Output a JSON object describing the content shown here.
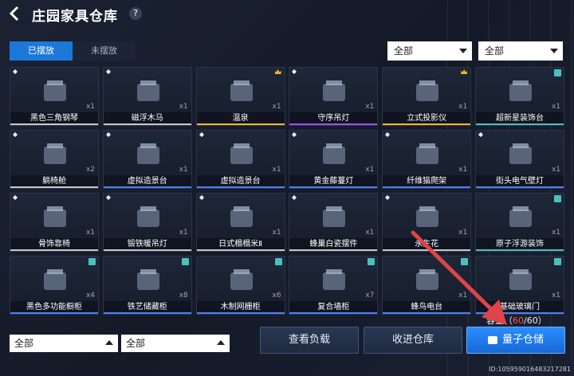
{
  "header": {
    "title": "庄园家具仓库",
    "help": "?"
  },
  "tabs": [
    {
      "label": "已摆放"
    },
    {
      "label": "未摆放"
    }
  ],
  "filters": {
    "top_left": "全部",
    "top_right": "全部",
    "bottom_left": "全部",
    "bottom_right": "全部"
  },
  "items": [
    {
      "name": "黑色三角钢琴",
      "qty": "x1",
      "badge": "gem",
      "rarity": "#c8c8c8"
    },
    {
      "name": "磁浮木马",
      "qty": "x1",
      "badge": "gem",
      "rarity": "#c8c8c8"
    },
    {
      "name": "温泉",
      "qty": "x1",
      "badge": "crown",
      "rarity": "#f0b62d"
    },
    {
      "name": "守序吊灯",
      "qty": "x1",
      "badge": "gem",
      "rarity": "#a64dff"
    },
    {
      "name": "立式投影仪",
      "qty": "x1",
      "badge": "crown",
      "rarity": "#f0b62d"
    },
    {
      "name": "超新星装饰台",
      "qty": "x1",
      "badge": "box",
      "rarity": "#4dbfbf"
    },
    {
      "name": "躺椅舱",
      "qty": "x2",
      "badge": "gem",
      "rarity": "#c8c8c8"
    },
    {
      "name": "虚拟造景台",
      "qty": "x1",
      "badge": "gem",
      "rarity": "#4d7fff"
    },
    {
      "name": "虚拟造景台",
      "qty": "x1",
      "badge": "gem",
      "rarity": "#4d7fff"
    },
    {
      "name": "黄金藤蔓灯",
      "qty": "x1",
      "badge": "gem",
      "rarity": "#4d7fff"
    },
    {
      "name": "纤维猫爬架",
      "qty": "x1",
      "badge": "gem",
      "rarity": "#4d7fff"
    },
    {
      "name": "街头电气壁灯",
      "qty": "x1",
      "badge": "gem",
      "rarity": "#4d7fff"
    },
    {
      "name": "骨饰靠椅",
      "qty": "x1",
      "badge": "gem",
      "rarity": "#c8c8c8"
    },
    {
      "name": "锻铁暖吊灯",
      "qty": "x1",
      "badge": "gem",
      "rarity": "#c8c8c8"
    },
    {
      "name": "日式榻榻米Ⅱ",
      "qty": "x1",
      "badge": "gem",
      "rarity": "#c8c8c8"
    },
    {
      "name": "蜂巢白瓷摆件",
      "qty": "x1",
      "badge": "gem",
      "rarity": "#c8c8c8"
    },
    {
      "name": "永生花",
      "qty": "x1",
      "badge": "gem",
      "rarity": "#c8c8c8"
    },
    {
      "name": "原子浮游装饰",
      "qty": "x1",
      "badge": "box",
      "rarity": "#4dbfbf"
    },
    {
      "name": "黑色多功能橱柜",
      "qty": "x4",
      "badge": "box",
      "rarity": "#4d7fff"
    },
    {
      "name": "铁艺储藏柜",
      "qty": "x8",
      "badge": "box",
      "rarity": "#4d7fff"
    },
    {
      "name": "木制网栅柜",
      "qty": "x6",
      "badge": "box",
      "rarity": "#4d7fff"
    },
    {
      "name": "复合墙柜",
      "qty": "x7",
      "badge": "box",
      "rarity": "#4d7fff"
    },
    {
      "name": "蜂鸟电台",
      "qty": "x1",
      "badge": "box",
      "rarity": "#4d7fff"
    },
    {
      "name": "基础玻璃门",
      "qty": "x1",
      "badge": "box",
      "rarity": "#4d7fff"
    }
  ],
  "capacity": {
    "label": "容量",
    "open": "（",
    "used": "60",
    "sep": "/",
    "total": "60",
    "close": "）"
  },
  "buttons": {
    "load": "查看负载",
    "return": "收进仓库",
    "quantum": "量子仓储"
  },
  "footer_id": "ID:105959016483217281",
  "colors": {
    "accent": "#1c78d8",
    "arrow": "#e0444a"
  }
}
